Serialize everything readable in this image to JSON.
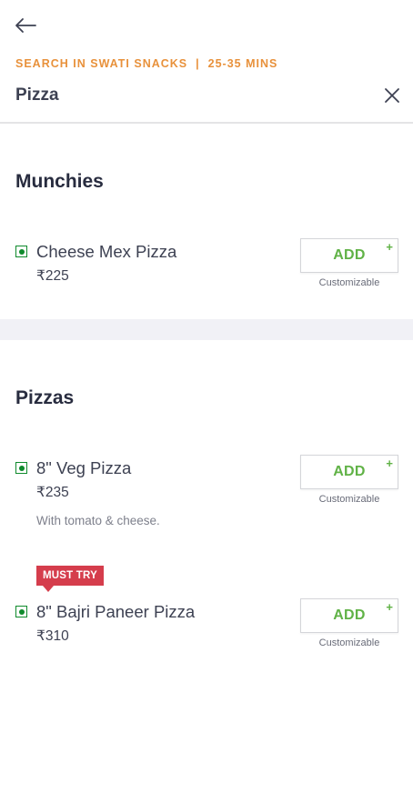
{
  "header": {
    "back_icon": "back-arrow-icon",
    "restaurant_label": "SEARCH IN SWATI SNACKS",
    "separator": "|",
    "delivery_time": "25-35 MINS",
    "search_query": "Pizza",
    "clear_icon": "close-icon"
  },
  "sections": [
    {
      "title": "Munchies",
      "items": [
        {
          "name": "Cheese Mex Pizza",
          "price": "₹225",
          "add_label": "ADD",
          "add_plus": "+",
          "customizable": "Customizable",
          "veg": true
        }
      ]
    },
    {
      "title": "Pizzas",
      "items": [
        {
          "name": "8\" Veg Pizza",
          "price": "₹235",
          "description": "With tomato & cheese.",
          "add_label": "ADD",
          "add_plus": "+",
          "customizable": "Customizable",
          "veg": true
        },
        {
          "badge": "MUST TRY",
          "name": "8\" Bajri Paneer Pizza",
          "price": "₹310",
          "add_label": "ADD",
          "add_plus": "+",
          "customizable": "Customizable",
          "veg": true
        }
      ]
    }
  ],
  "colors": {
    "accent_orange": "#e8913b",
    "add_green": "#60b246",
    "veg_green": "#0f8a2c",
    "badge_red": "#d53d4c"
  }
}
